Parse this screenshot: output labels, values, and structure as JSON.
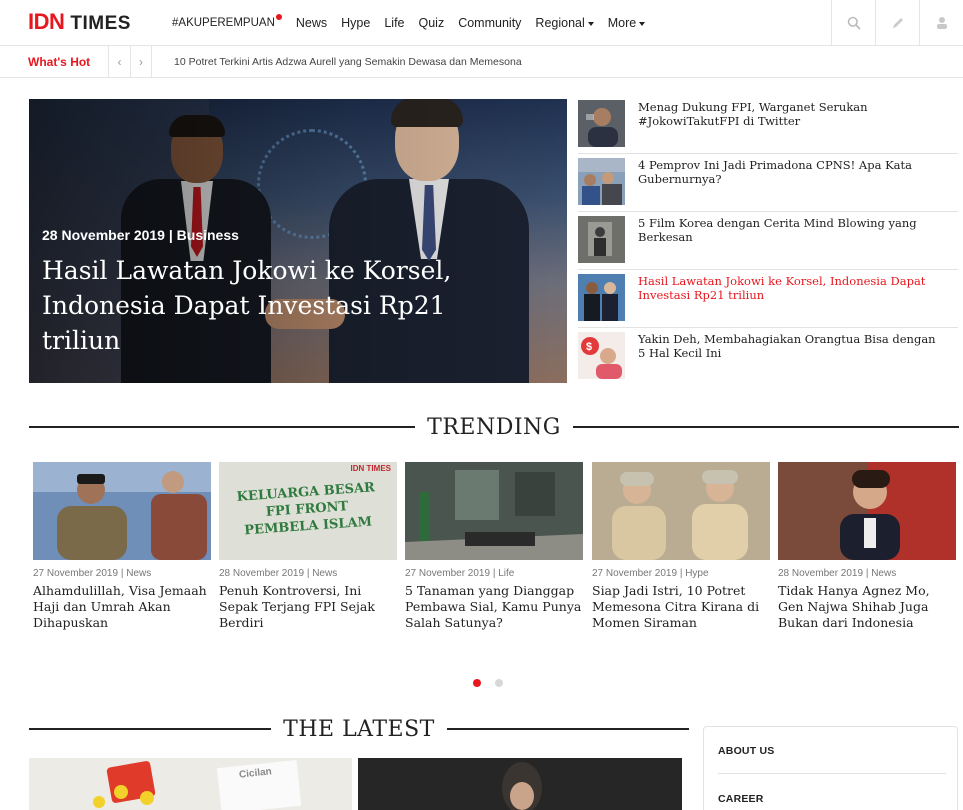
{
  "header": {
    "logo_idn": "IDN",
    "logo_times": "TIMES",
    "nav": [
      {
        "label": "#AKUPEREMPUAN"
      },
      {
        "label": "News"
      },
      {
        "label": "Hype"
      },
      {
        "label": "Life"
      },
      {
        "label": "Quiz"
      },
      {
        "label": "Community"
      },
      {
        "label": "Regional"
      },
      {
        "label": "More"
      }
    ],
    "icons": [
      "search-icon",
      "pencil-icon",
      "user-icon"
    ]
  },
  "whats_hot": {
    "label": "What's Hot",
    "text": "10 Potret Terkini Artis Adzwa Aurell yang Semakin Dewasa dan Memesona"
  },
  "hero": {
    "meta": "28 November 2019 | Business",
    "title": "Hasil Lawatan Jokowi ke Korsel, Indonesia Dapat Investasi Rp21 triliun"
  },
  "side_list": [
    {
      "title": "Menag Dukung FPI, Warganet Serukan #JokowiTakutFPI di Twitter"
    },
    {
      "title": "4 Pemprov Ini Jadi Primadona CPNS! Apa Kata Gubernurnya?"
    },
    {
      "title": "5 Film Korea dengan Cerita Mind Blowing yang Berkesan"
    },
    {
      "title": "Hasil Lawatan Jokowi ke Korsel, Indonesia Dapat Investasi Rp21 triliun"
    },
    {
      "title": "Yakin Deh, Membahagiakan Orangtua Bisa dengan 5 Hal Kecil Ini"
    }
  ],
  "trending": {
    "heading": "TRENDING",
    "items": [
      {
        "meta": "27 November 2019 | News",
        "title": "Alhamdulillah, Visa Jemaah Haji dan Umrah Akan Dihapuskan"
      },
      {
        "meta": "28 November 2019 | News",
        "title": "Penuh Kontroversi, Ini Sepak Terjang FPI Sejak Berdiri",
        "img_text": "KELUARGA BESAR FPI FRONT PEMBELA ISLAM",
        "img_brand": "IDN TIMES"
      },
      {
        "meta": "27 November 2019 | Life",
        "title": "5 Tanaman yang Dianggap Pembawa Sial, Kamu Punya Salah Satunya?"
      },
      {
        "meta": "27 November 2019 | Hype",
        "title": "Siap Jadi Istri, 10 Potret Memesona Citra Kirana di Momen Siraman"
      },
      {
        "meta": "28 November 2019 | News",
        "title": "Tidak Hanya Agnez Mo, Gen Najwa Shihab Juga Bukan dari Indonesia"
      }
    ]
  },
  "latest": {
    "heading": "THE LATEST",
    "img1_text": "Cicilan"
  },
  "about": {
    "links": [
      "ABOUT US",
      "CAREER"
    ]
  },
  "colors": {
    "brand_red": "#e7171e"
  }
}
